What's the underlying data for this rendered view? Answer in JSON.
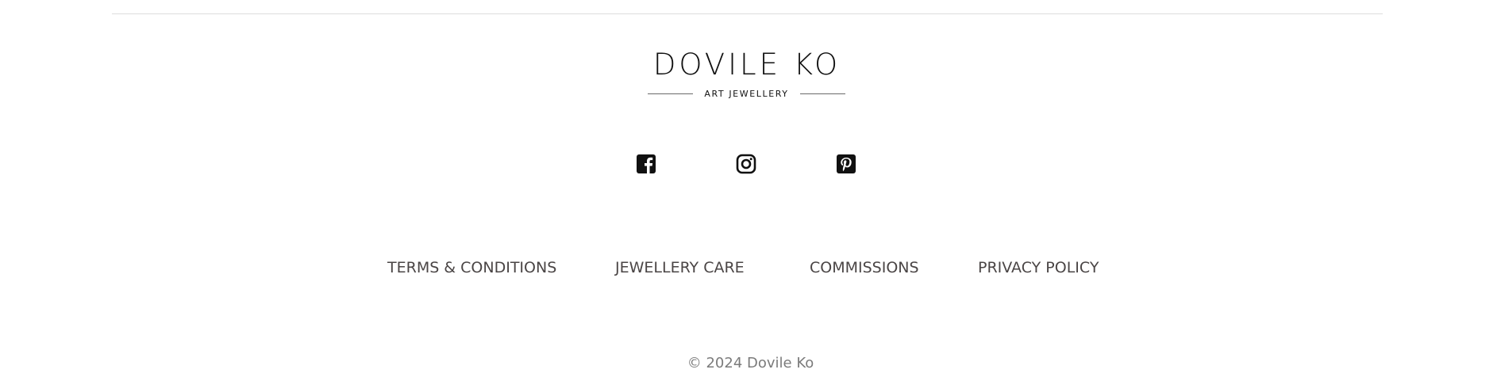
{
  "footer": {
    "logo": {
      "name": "DOVILE KO",
      "tagline": "ART JEWELLERY"
    },
    "social": [
      {
        "icon": "facebook-icon"
      },
      {
        "icon": "instagram-icon"
      },
      {
        "icon": "pinterest-icon"
      }
    ],
    "nav": {
      "terms": "TERMS & CONDITIONS",
      "care": "JEWELLERY CARE",
      "commissions": "COMMISSIONS",
      "privacy": "PRIVACY POLICY"
    },
    "copyright": "© 2024 Dovile Ko",
    "colors": {
      "background": "#ffffff",
      "icon": "#111111",
      "nav_text": "#4a4545",
      "copyright_text": "#7b7b7b",
      "divider": "#dcdcdc"
    }
  }
}
